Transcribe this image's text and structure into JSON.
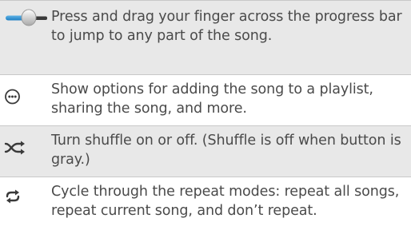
{
  "rows": [
    {
      "icon": "progress-slider-icon",
      "text": "Press and drag your finger across the progress bar to jump to any part of the song."
    },
    {
      "icon": "more-options-icon",
      "text": "Show options for adding the song to a playlist, sharing the song, and more."
    },
    {
      "icon": "shuffle-icon",
      "text": "Turn shuffle on or off. (Shuffle is off when button is gray.)"
    },
    {
      "icon": "repeat-icon",
      "text": "Cycle through the repeat modes: repeat all songs, repeat current song, and don’t repeat."
    }
  ],
  "colors": {
    "row_shade": "#e8e8e8",
    "divider": "#c8c8c8",
    "text": "#4a4a4a",
    "slider_fill": "#2a8fd0",
    "icon_dark": "#3a3a3a"
  }
}
